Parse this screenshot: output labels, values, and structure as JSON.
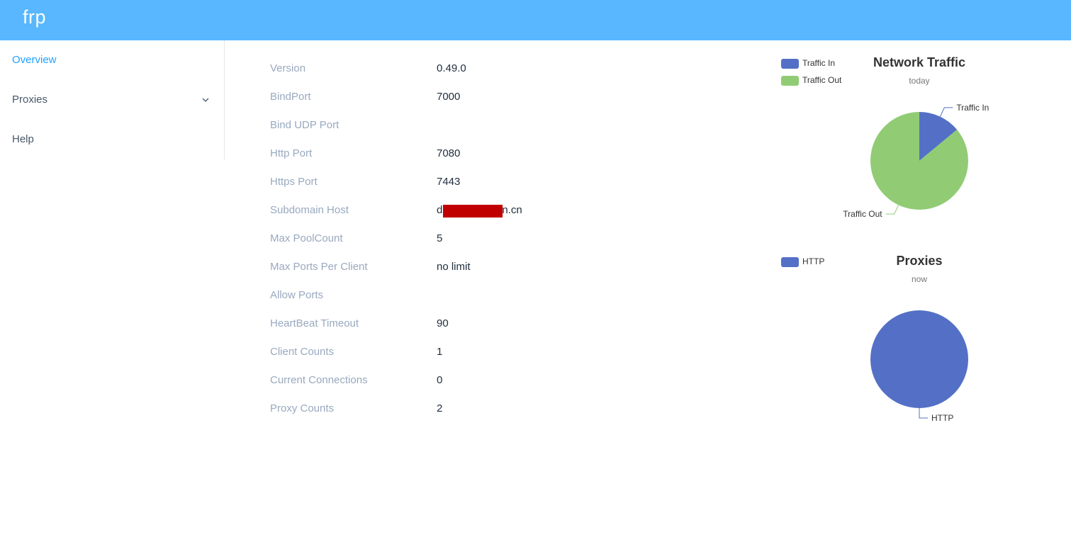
{
  "app": {
    "title": "frp"
  },
  "sidebar": {
    "items": [
      {
        "label": "Overview",
        "active": true
      },
      {
        "label": "Proxies",
        "expandable": true
      },
      {
        "label": "Help"
      }
    ]
  },
  "overview": {
    "rows": [
      {
        "label": "Version",
        "value": "0.49.0"
      },
      {
        "label": "BindPort",
        "value": "7000"
      },
      {
        "label": "Bind UDP Port",
        "value": ""
      },
      {
        "label": "Http Port",
        "value": "7080"
      },
      {
        "label": "Https Port",
        "value": "7443"
      },
      {
        "label": "Subdomain Host",
        "value_prefix": "d",
        "value_suffix": "n.cn",
        "redacted": true
      },
      {
        "label": "Max PoolCount",
        "value": "5"
      },
      {
        "label": "Max Ports Per Client",
        "value": "no limit"
      },
      {
        "label": "Allow Ports",
        "value": ""
      },
      {
        "label": "HeartBeat Timeout",
        "value": "90"
      },
      {
        "label": "Client Counts",
        "value": "1"
      },
      {
        "label": "Current Connections",
        "value": "0"
      },
      {
        "label": "Proxy Counts",
        "value": "2"
      }
    ]
  },
  "colors": {
    "header": "#58b7ff",
    "active_nav": "#20a0ff",
    "series_1": "#5470c6",
    "series_2": "#91cc75",
    "redaction": "#c00000"
  },
  "icons": {
    "proxies_expand": "chevron-down-icon"
  },
  "chart_data": [
    {
      "type": "pie",
      "title": "Network Traffic",
      "subtitle": "today",
      "legend": "top-left",
      "categories": [
        "Traffic In",
        "Traffic Out"
      ],
      "values": [
        14,
        86
      ],
      "colors": [
        "#5470c6",
        "#91cc75"
      ]
    },
    {
      "type": "pie",
      "title": "Proxies",
      "subtitle": "now",
      "legend": "top-left",
      "categories": [
        "HTTP"
      ],
      "values": [
        2
      ],
      "colors": [
        "#5470c6"
      ]
    }
  ]
}
